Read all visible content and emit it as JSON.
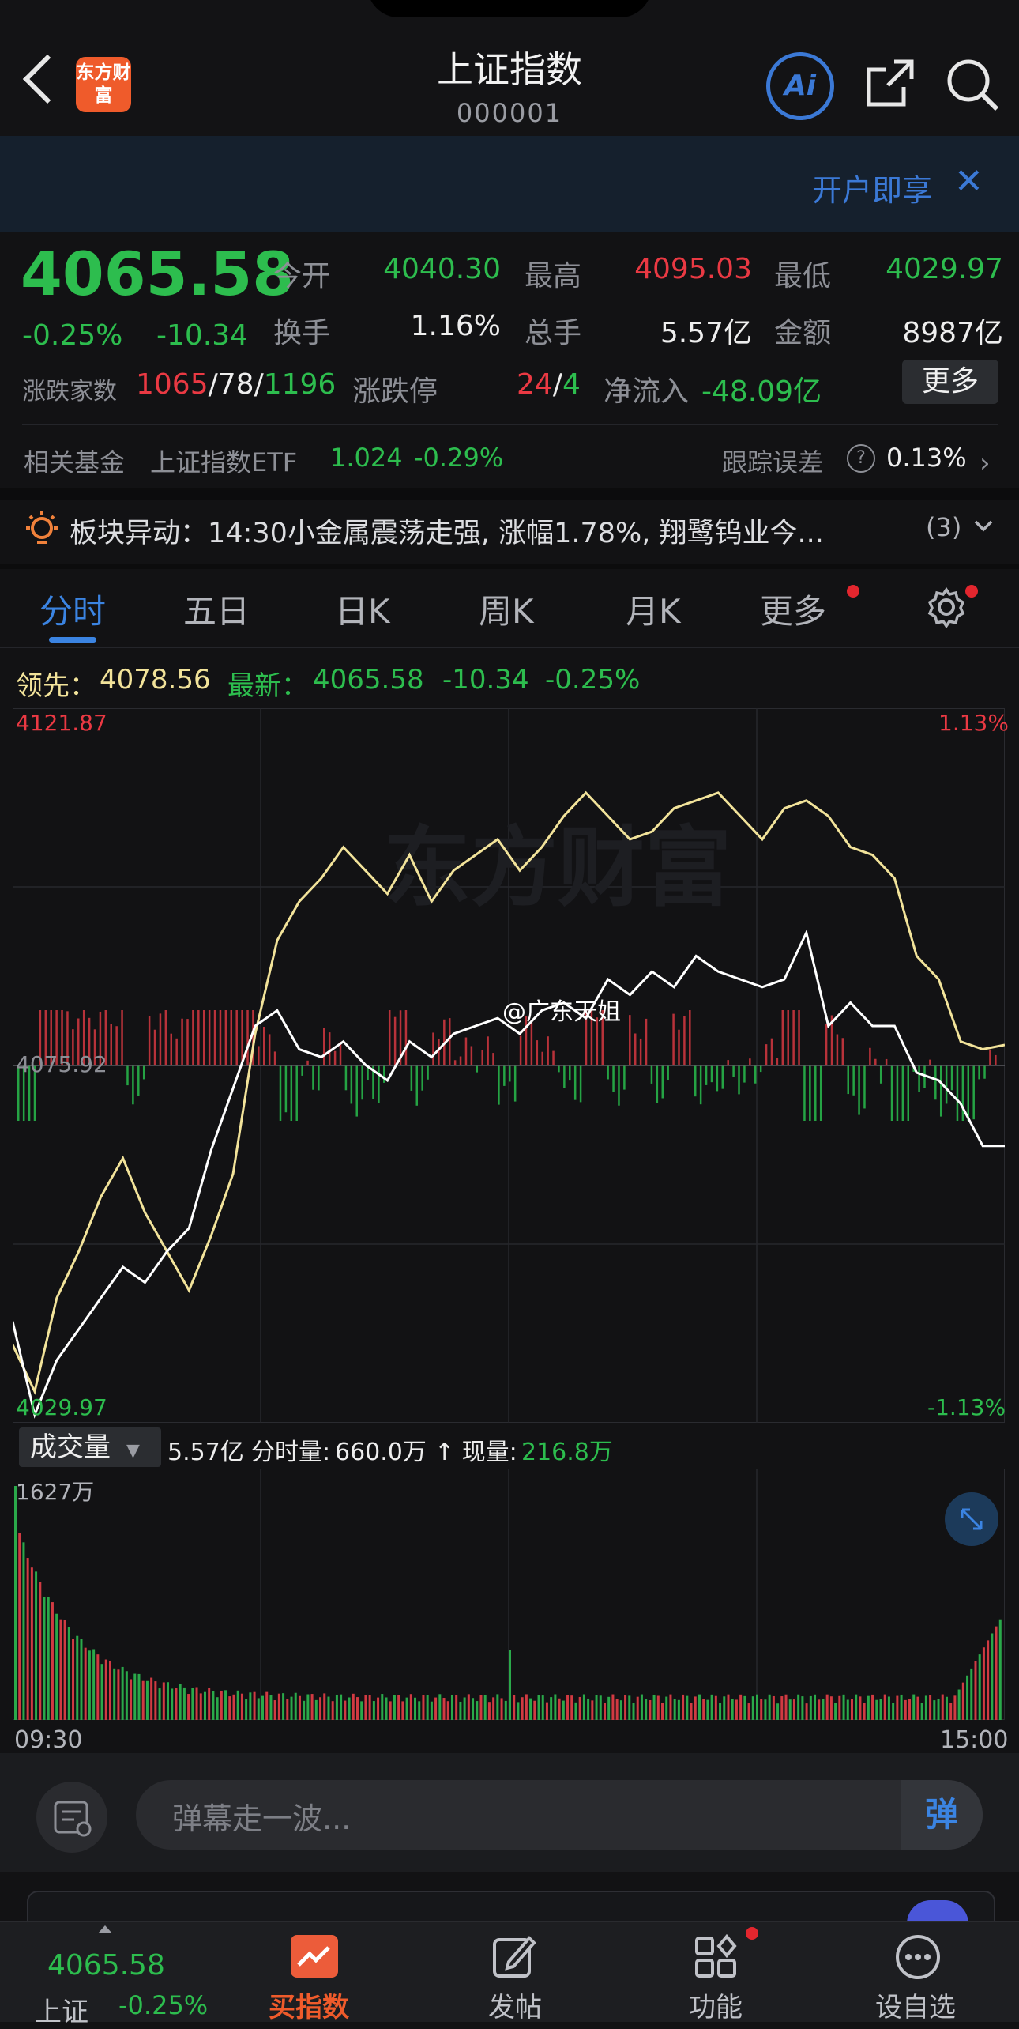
{
  "header": {
    "logo_text": "东方财富",
    "title": "上证指数",
    "code": "000001",
    "ai_label": "Ai"
  },
  "banner": {
    "text": "开户即享",
    "close": "✕"
  },
  "quote": {
    "price": "4065.58",
    "change_pct": "-0.25%",
    "change": "-10.34",
    "open_label": "今开",
    "open": "4040.30",
    "high_label": "最高",
    "high": "4095.03",
    "low_label": "最低",
    "low": "4029.97",
    "turnover_label": "换手",
    "turnover": "1.16%",
    "volume_label": "总手",
    "volume": "5.57亿",
    "amount_label": "金额",
    "amount": "8987亿",
    "breadth_label": "涨跌家数",
    "up": "1065",
    "flat": "78",
    "down": "1196",
    "limit_label": "涨跌停",
    "limit_up": "24",
    "limit_down": "4",
    "netflow_label": "净流入",
    "netflow": "-48.09亿",
    "more_button": "更多"
  },
  "fund": {
    "label": "相关基金",
    "name": "上证指数ETF",
    "price": "1.024",
    "pct": "-0.29%",
    "track_label": "跟踪误差",
    "track_value": "0.13%"
  },
  "alert": {
    "text": "板块异动：14:30小金属震荡走强, 涨幅1.78%, 翔鹭钨业今...",
    "count": "(3)"
  },
  "tabs": [
    {
      "label": "分时"
    },
    {
      "label": "五日"
    },
    {
      "label": "日K"
    },
    {
      "label": "周K"
    },
    {
      "label": "月K"
    },
    {
      "label": "更多"
    }
  ],
  "legend": {
    "lead_label": "领先：",
    "lead": "4078.56",
    "latest_label": "最新：",
    "latest": "4065.58",
    "change": "-10.34",
    "pct": "-0.25%"
  },
  "chart_axis": {
    "top": "4121.87",
    "prev_close": "4075.92",
    "bottom": "4029.97",
    "top_pct": "1.13%",
    "bottom_pct": "-1.13%",
    "watermark": "东方财富",
    "credit": "@广东天姐"
  },
  "volume_info": {
    "selector": "成交量",
    "total": "5.57亿",
    "minute_label": "分时量:",
    "minute": "660.0万",
    "now_label": "↑ 现量:",
    "now": "216.8万",
    "max": "1627万",
    "start": "09:30",
    "end": "15:00"
  },
  "comment": {
    "placeholder": "弹幕走一波...",
    "dan": "弹"
  },
  "nav": {
    "price": "4065.58",
    "name": "上证",
    "pct": "-0.25%",
    "items": [
      "买指数",
      "发帖",
      "功能",
      "设自选"
    ]
  },
  "colors": {
    "up": "#ea3943",
    "down": "#2dbd4e",
    "accent": "#3b84e2",
    "lead_line": "#f2e39a",
    "index_line": "#ffffff"
  },
  "chart_data": {
    "type": "line",
    "x_range": [
      "09:30",
      "15:00"
    ],
    "ylim": [
      4029.97,
      4121.87
    ],
    "prev_close": 4075.92,
    "series": [
      {
        "name": "领先",
        "values": [
          4040,
          4034,
          4046,
          4052,
          4059,
          4064,
          4057,
          4052,
          4047,
          4054,
          4062,
          4080,
          4092,
          4097,
          4100,
          4104,
          4101,
          4098,
          4103,
          4097,
          4101,
          4103,
          4105,
          4101,
          4104,
          4108,
          4111,
          4108,
          4105,
          4106,
          4109,
          4110,
          4111,
          4108,
          4105,
          4109,
          4110,
          4108,
          4104,
          4103,
          4100,
          4090,
          4087,
          4079,
          4078,
          4078.56
        ]
      },
      {
        "name": "最新",
        "values": [
          4043,
          4031,
          4038,
          4042,
          4046,
          4050,
          4048,
          4052,
          4055,
          4065,
          4073,
          4081,
          4083,
          4078,
          4077,
          4079,
          4076,
          4074,
          4079,
          4077,
          4080,
          4081,
          4082,
          4080,
          4083,
          4084,
          4082,
          4087,
          4085,
          4088,
          4086,
          4090,
          4088,
          4087,
          4086,
          4087,
          4093,
          4081,
          4084,
          4081,
          4081,
          4075,
          4074,
          4071,
          4065.58,
          4065.58
        ]
      }
    ]
  }
}
